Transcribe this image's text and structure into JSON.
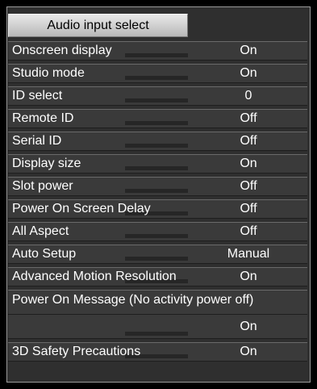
{
  "menu": {
    "title": "Audio input select",
    "items": [
      {
        "label": "Onscreen display",
        "value": "On"
      },
      {
        "label": "Studio mode",
        "value": "On"
      },
      {
        "label": "ID select",
        "value": "0"
      },
      {
        "label": "Remote ID",
        "value": "Off"
      },
      {
        "label": "Serial ID",
        "value": "Off"
      },
      {
        "label": "Display size",
        "value": "On"
      },
      {
        "label": "Slot power",
        "value": "Off"
      },
      {
        "label": "Power On Screen Delay",
        "value": "Off"
      },
      {
        "label": "All Aspect",
        "value": "Off"
      },
      {
        "label": "Auto Setup",
        "value": "Manual"
      },
      {
        "label": "Advanced Motion Resolution",
        "value": "On"
      }
    ],
    "power_on_message": {
      "label": "Power On Message (No activity power off)",
      "value": "On"
    },
    "safety": {
      "label": "3D Safety Precautions",
      "value": "On"
    }
  },
  "colors": {
    "background": "#000000",
    "panel": "#2f2f2f",
    "row": "#3a3a3a",
    "text": "#ffffff",
    "title_tab": "#d3d3d3"
  }
}
